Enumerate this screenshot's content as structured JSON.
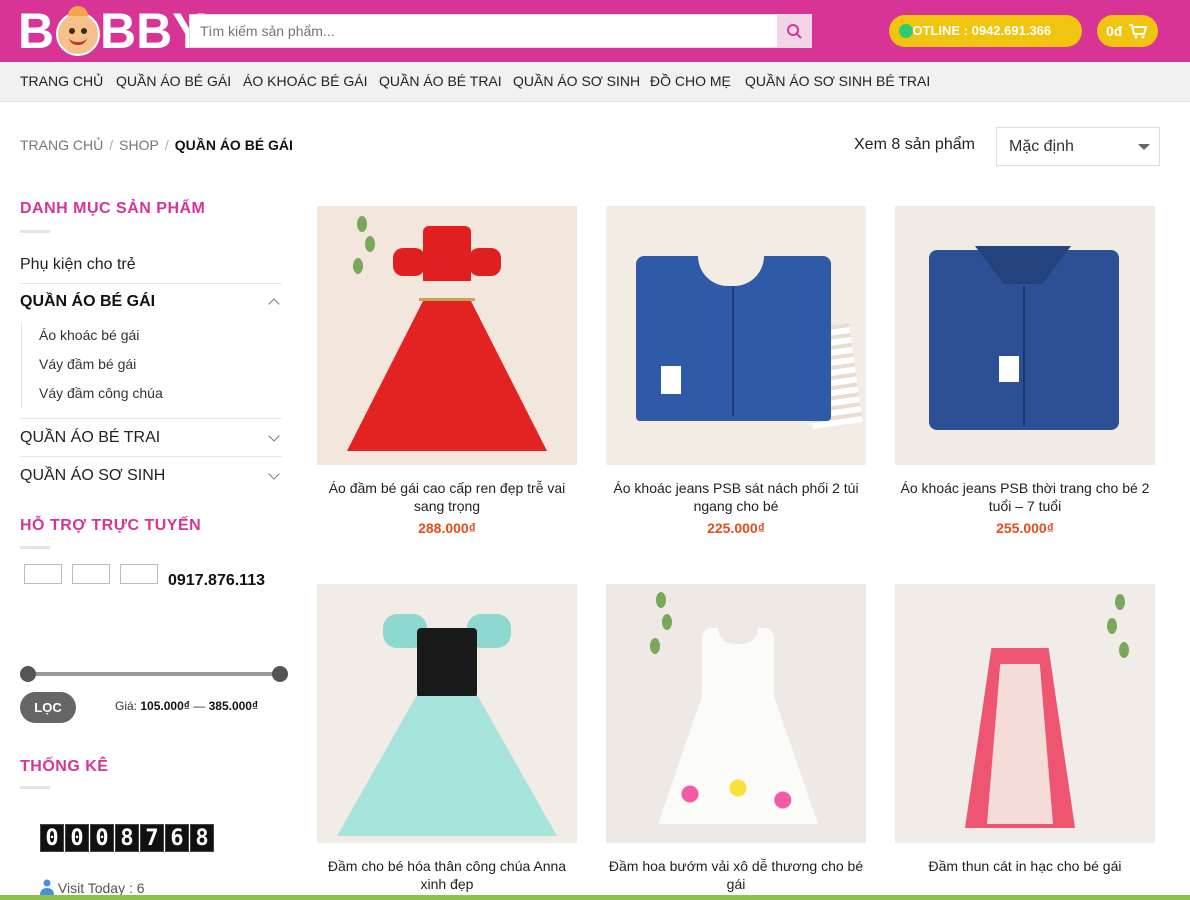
{
  "header": {
    "logo_letters": [
      "B",
      "BBY"
    ],
    "search_placeholder": "Tìm kiếm sản phẩm...",
    "hotline": "HOTLINE : 0942.691.366",
    "cart": "0đ"
  },
  "nav": [
    "TRANG CHỦ",
    "QUẦN ÁO BÉ GÁI",
    "ÁO KHOÁC BÉ GÁI",
    "QUẦN ÁO BÉ TRAI",
    "QUẦN ÁO SƠ SINH",
    "ĐỒ CHO MẸ",
    "QUẦN ÁO SƠ SINH BÉ TRAI"
  ],
  "breadcrumb": {
    "home": "TRANG CHỦ",
    "shop": "SHOP",
    "current": "QUẦN ÁO BÉ GÁI",
    "sep": "/"
  },
  "toolbar": {
    "result_count": "Xem 8 sản phẩm",
    "sort_value": "Mặc định"
  },
  "sidebar": {
    "category_title": "DANH MỤC SẢN PHẨM",
    "categories": {
      "accessories": "Phụ kiện cho trẻ",
      "girls": "QUẦN ÁO BÉ GÁI",
      "girls_sub": [
        "Áo khoác bé gái",
        "Váy đầm bé gái",
        "Váy đầm công chúa"
      ],
      "boys": "QUẦN ÁO BÉ TRAI",
      "newborn": "QUẦN ÁO SƠ SINH"
    },
    "support_title": "HỖ TRỢ TRỰC TUYẾN",
    "support_phone": "0917.876.113",
    "filter_button": "LỌC",
    "price_label": "Giá:",
    "price_min": "105.000₫",
    "price_dash": "—",
    "price_max": "385.000₫",
    "stats_title": "THỐNG KÊ",
    "counter_digits": [
      "0",
      "0",
      "0",
      "8",
      "7",
      "6",
      "8"
    ],
    "visit_today": "Visit Today : 6"
  },
  "products": [
    {
      "name": "Áo đầm bé gái cao cấp ren đẹp trễ vai sang trọng",
      "price": "288.000₫"
    },
    {
      "name": "Áo khoác jeans PSB sát nách phối 2 túi ngang cho bé",
      "price": "225.000₫"
    },
    {
      "name": "Áo khoác jeans PSB thời trang cho bé 2 tuổi – 7 tuổi",
      "price": "255.000₫"
    },
    {
      "name": "Đầm cho bé hóa thân công chúa Anna xinh đẹp",
      "price": ""
    },
    {
      "name": "Đầm hoa bướm vải xô dễ thương cho bé gái",
      "price": ""
    },
    {
      "name": "Đầm thun cát in hạc cho bé gái",
      "price": ""
    }
  ],
  "colors": {
    "brand": "#d73496",
    "hotline": "#f0c40f",
    "price": "#e44c1c",
    "filter_bg": "#8bc34a"
  }
}
